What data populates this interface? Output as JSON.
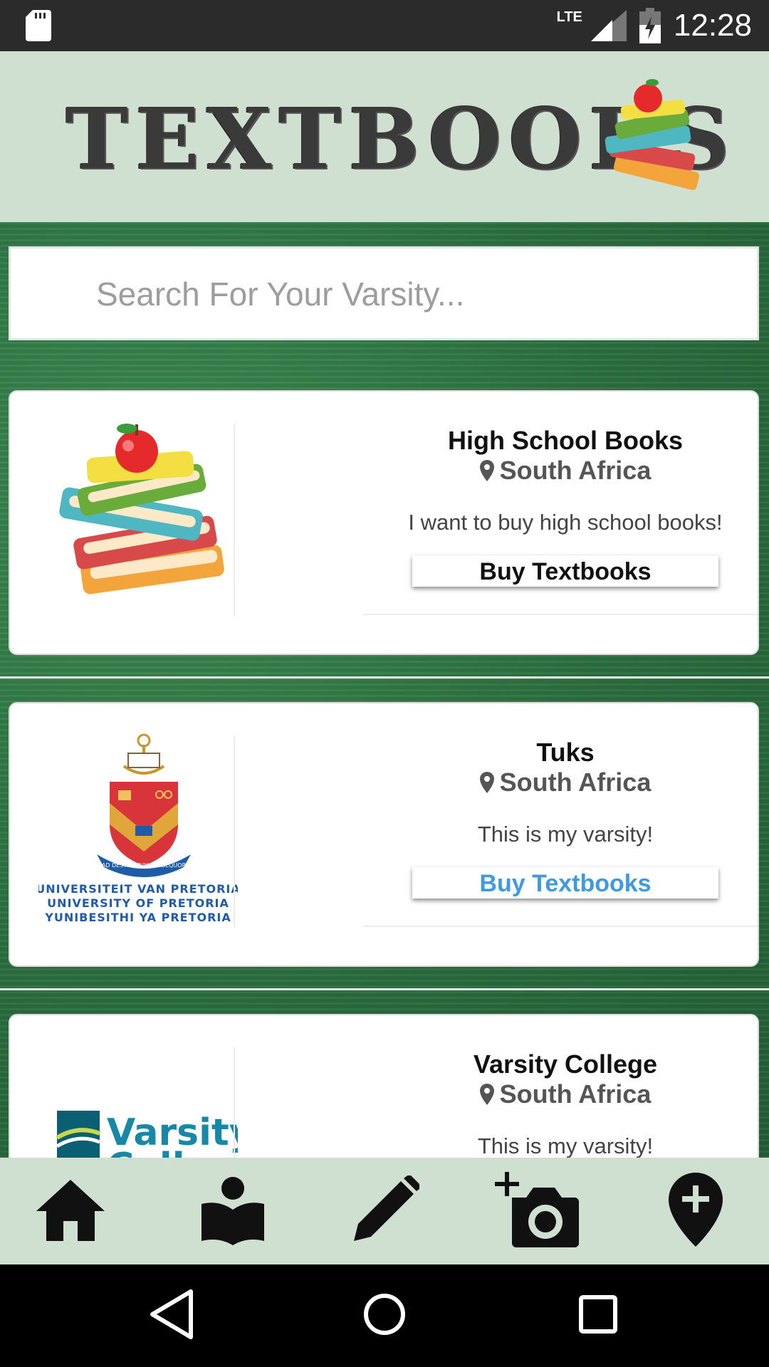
{
  "status_bar": {
    "time": "12:28",
    "network": "LTE"
  },
  "header": {
    "app_title": "TEXTBOOKS"
  },
  "search": {
    "placeholder": "Search For Your Varsity..."
  },
  "cards": [
    {
      "title": "High School Books",
      "location": "South Africa",
      "description": "I want to buy high school books!",
      "button": "Buy Textbooks"
    },
    {
      "title": "Tuks",
      "location": "South Africa",
      "description": "This is my varsity!",
      "button": "Buy Textbooks",
      "logo_lines": [
        "UNIVERSITEIT VAN PRETORIA",
        "UNIVERSITY OF PRETORIA",
        "YUNIBESITHI YA PRETORIA"
      ],
      "motto": "AD DESTINATUM PERSEQUOR"
    },
    {
      "title": "Varsity College",
      "location": "South Africa",
      "description": "This is my varsity!",
      "logo_text": [
        "Varsity",
        "College"
      ]
    }
  ],
  "bottom_nav": [
    "home-icon",
    "book-reader-icon",
    "pencil-icon",
    "add-photo-icon",
    "add-location-icon"
  ],
  "colors": {
    "header_bg": "#cfe0d0",
    "board_green": "#2a6e3e",
    "link_blue": "#3f9ae0",
    "status_bar": "#2b2b2b"
  }
}
